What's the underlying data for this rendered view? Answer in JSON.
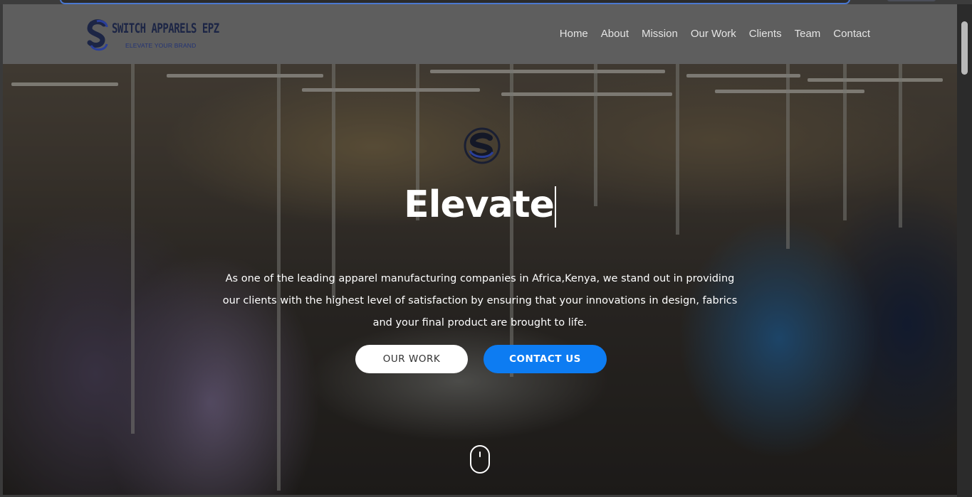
{
  "brand": {
    "name": "SWITCH APPARELS EPZ",
    "tagline": "ELEVATE YOUR BRAND",
    "primary_color": "#1c2545",
    "accent_color": "#0d7cf2"
  },
  "nav": {
    "items": [
      {
        "label": "Home"
      },
      {
        "label": "About"
      },
      {
        "label": "Mission"
      },
      {
        "label": "Our Work"
      },
      {
        "label": "Clients"
      },
      {
        "label": "Team"
      },
      {
        "label": "Contact"
      }
    ]
  },
  "hero": {
    "icon": "switch-logo-icon",
    "title": "Elevate",
    "description": "As one of the leading apparel manufacturing companies in Africa,Kenya, we stand out in providing our clients with the highest level of satisfaction by ensuring that your innovations in design, fabrics and your final product are brought to life.",
    "primary_button": "OUR WORK",
    "secondary_button": "CONTACT US",
    "scroll_icon": "mouse-scroll-icon"
  }
}
